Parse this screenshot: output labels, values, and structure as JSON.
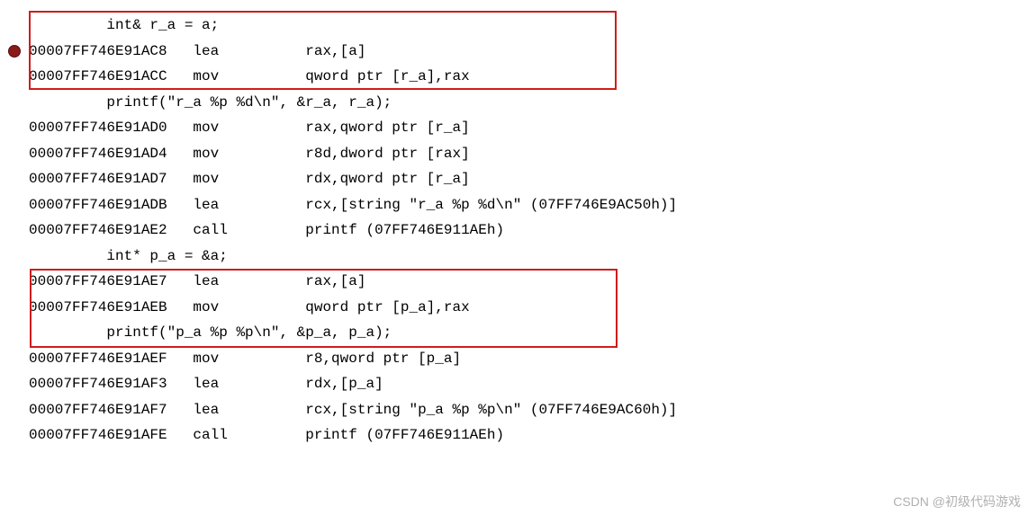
{
  "lines": [
    {
      "gutter": "",
      "indent": "",
      "address": "",
      "text": "     int& r_a = a;"
    },
    {
      "gutter": "breakpoint",
      "indent": "",
      "address": "00007FF746E91AC8",
      "mnemonic": "lea",
      "operands": "rax,[a]"
    },
    {
      "gutter": "",
      "indent": "",
      "address": "00007FF746E91ACC",
      "mnemonic": "mov",
      "operands": "qword ptr [r_a],rax"
    },
    {
      "gutter": "",
      "indent": "",
      "address": "",
      "text": "     printf(\"r_a %p %d\\n\", &r_a, r_a);"
    },
    {
      "gutter": "",
      "indent": "",
      "address": "00007FF746E91AD0",
      "mnemonic": "mov",
      "operands": "rax,qword ptr [r_a]"
    },
    {
      "gutter": "",
      "indent": "",
      "address": "00007FF746E91AD4",
      "mnemonic": "mov",
      "operands": "r8d,dword ptr [rax]"
    },
    {
      "gutter": "",
      "indent": "",
      "address": "00007FF746E91AD7",
      "mnemonic": "mov",
      "operands": "rdx,qword ptr [r_a]"
    },
    {
      "gutter": "",
      "indent": "",
      "address": "00007FF746E91ADB",
      "mnemonic": "lea",
      "operands": "rcx,[string \"r_a %p %d\\n\" (07FF746E9AC50h)]"
    },
    {
      "gutter": "",
      "indent": "",
      "address": "00007FF746E91AE2",
      "mnemonic": "call",
      "operands": "printf (07FF746E911AEh)"
    },
    {
      "gutter": "",
      "indent": "",
      "address": "",
      "text": "     int* p_a = &a;"
    },
    {
      "gutter": "",
      "indent": "",
      "address": "00007FF746E91AE7",
      "mnemonic": "lea",
      "operands": "rax,[a]"
    },
    {
      "gutter": "",
      "indent": "",
      "address": "00007FF746E91AEB",
      "mnemonic": "mov",
      "operands": "qword ptr [p_a],rax"
    },
    {
      "gutter": "",
      "indent": "",
      "address": "",
      "text": "     printf(\"p_a %p %p\\n\", &p_a, p_a);"
    },
    {
      "gutter": "",
      "indent": "",
      "address": "00007FF746E91AEF",
      "mnemonic": "mov",
      "operands": "r8,qword ptr [p_a]"
    },
    {
      "gutter": "",
      "indent": "",
      "address": "00007FF746E91AF3",
      "mnemonic": "lea",
      "operands": "rdx,[p_a]"
    },
    {
      "gutter": "",
      "indent": "",
      "address": "00007FF746E91AF7",
      "mnemonic": "lea",
      "operands": "rcx,[string \"p_a %p %p\\n\" (07FF746E9AC60h)]"
    },
    {
      "gutter": "",
      "indent": "",
      "address": "00007FF746E91AFE",
      "mnemonic": "call",
      "operands": "printf (07FF746E911AEh)"
    }
  ],
  "watermark": "CSDN @初级代码游戏"
}
